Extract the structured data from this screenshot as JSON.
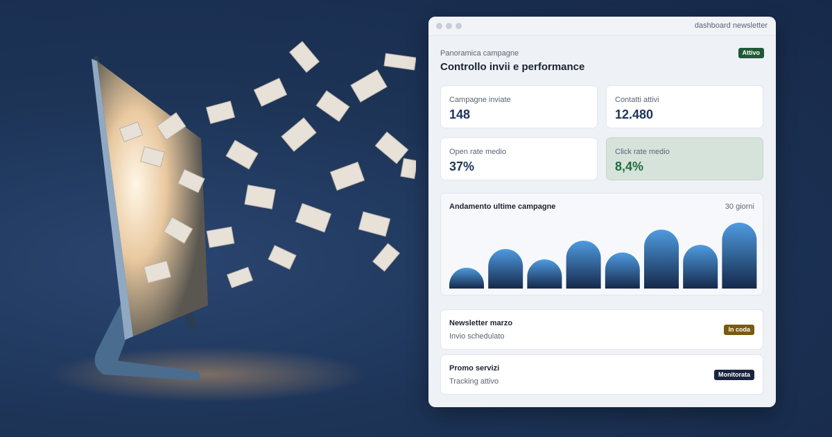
{
  "window": {
    "title": "dashboard newsletter"
  },
  "header": {
    "subtitle": "Panoramica campagne",
    "title": "Controllo invii e performance",
    "status_badge": "Attivo"
  },
  "stats": [
    {
      "label": "Campagne inviate",
      "value": "148"
    },
    {
      "label": "Contatti attivi",
      "value": "12.480"
    },
    {
      "label": "Open rate medio",
      "value": "37%"
    },
    {
      "label": "Click rate medio",
      "value": "8,4%"
    }
  ],
  "chart": {
    "title": "Andamento ultime campagne",
    "range": "30 giorni"
  },
  "chart_data": {
    "type": "bar",
    "title": "Andamento ultime campagne",
    "values": [
      30,
      57,
      42,
      69,
      52,
      85,
      63,
      95
    ],
    "ylim": [
      0,
      100
    ],
    "grid": false,
    "legend": "none"
  },
  "campaigns": [
    {
      "name": "Newsletter marzo",
      "status": "Invio schedulato",
      "badge": "In coda"
    },
    {
      "name": "Promo servizi",
      "status": "Tracking attivo",
      "badge": "Monitorata"
    }
  ],
  "colors": {
    "accent": "#1c3559",
    "active_badge": "#1f5a36",
    "queue_badge": "#7a5a0e",
    "monitor_badge": "#18253d",
    "bar_top": "#4f9be0",
    "bar_bottom": "#15294a"
  }
}
